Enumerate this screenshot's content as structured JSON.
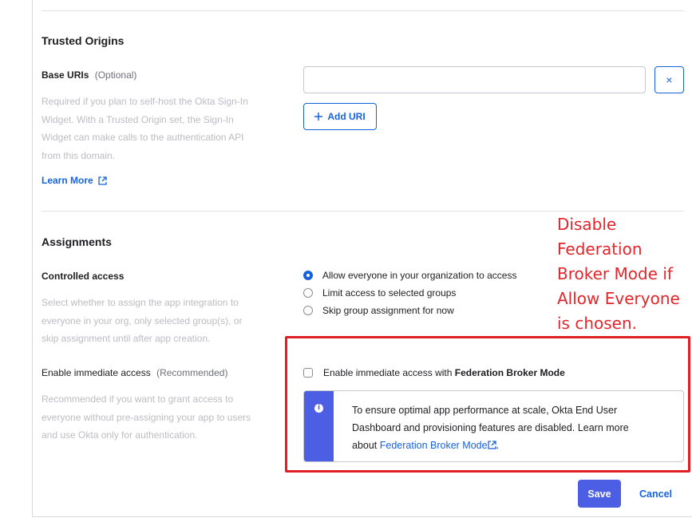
{
  "trusted_origins": {
    "heading": "Trusted Origins",
    "base_uris_label": "Base URIs",
    "base_uris_optional": "(Optional)",
    "help_lines": [
      "Required if you plan to self-host the Okta Sign-In",
      "Widget. With a Trusted Origin set, the Sign-In",
      "Widget can make calls to the authentication API",
      "from this domain."
    ],
    "learn_more": "Learn More",
    "uri_value": "",
    "remove_symbol": "×",
    "add_uri_label": "Add URI"
  },
  "assignments": {
    "heading": "Assignments",
    "controlled_access_label": "Controlled access",
    "controlled_help_lines": [
      "Select whether to assign the app integration to",
      "everyone in your org, only selected group(s), or",
      "skip assignment until after app creation."
    ],
    "options": [
      {
        "label": "Allow everyone in your organization to access",
        "selected": true
      },
      {
        "label": "Limit access to selected groups",
        "selected": false
      },
      {
        "label": "Skip group assignment for now",
        "selected": false
      }
    ],
    "immediate_label": "Enable immediate access",
    "immediate_recommended": "(Recommended)",
    "immediate_help_lines": [
      "Recommended if you want to grant access to",
      "everyone without pre-assigning your app to users",
      "and use Okta only for authentication."
    ],
    "checkbox_prefix": "Enable immediate access with ",
    "checkbox_bold": "Federation Broker Mode",
    "checkbox_checked": false,
    "callout_line1": "To ensure optimal app performance at scale, Okta End User",
    "callout_line2": "Dashboard and provisioning features are disabled. Learn more",
    "callout_line3_prefix": "about ",
    "callout_link": "Federation Broker Mode",
    "callout_line3_suffix": "."
  },
  "annotation": {
    "lines": [
      "Disable",
      "Federation",
      "Broker Mode if",
      "Allow Everyone",
      "is chosen."
    ],
    "color": "#e3262b"
  },
  "footer": {
    "save": "Save",
    "cancel": "Cancel"
  },
  "colors": {
    "accent": "#1662dd",
    "primary_button": "#4b5ee4",
    "highlight_box": "#e01f24"
  }
}
